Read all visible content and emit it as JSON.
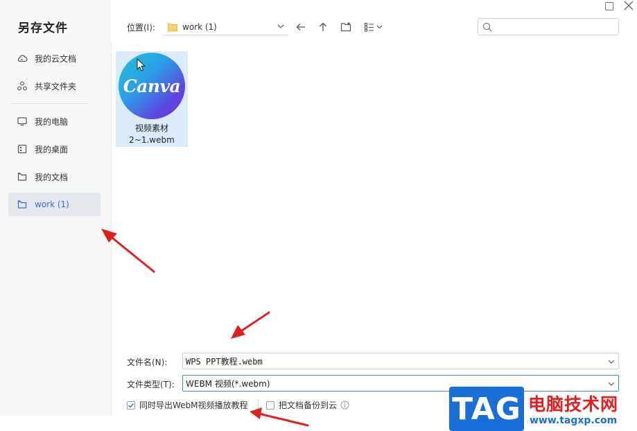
{
  "dialog": {
    "title": "另存文件"
  },
  "sidebar": {
    "items": [
      {
        "label": "我的云文档",
        "icon": "cloud-icon"
      },
      {
        "label": "共享文件夹",
        "icon": "share-icon"
      },
      {
        "label": "我的电脑",
        "icon": "monitor-icon"
      },
      {
        "label": "我的桌面",
        "icon": "desktop-icon"
      },
      {
        "label": "我的文档",
        "icon": "document-icon"
      },
      {
        "label": "work (1)",
        "icon": "folder-icon",
        "active": true
      }
    ]
  },
  "toolbar": {
    "location_label": "位置(I):",
    "location_value": "work (1)",
    "search_placeholder": ""
  },
  "files": [
    {
      "logo_text": "Canva",
      "name_line1": "视频素材",
      "name_line2": "2~1.webm"
    }
  ],
  "form": {
    "filename_label": "文件名(N):",
    "filename_value": "WPS PPT教程.webm",
    "filetype_label": "文件类型(T):",
    "filetype_value": "WEBM 视频(*.webm)",
    "export_tutorial_label": "同时导出WebM视频播放教程",
    "export_tutorial_checked": true,
    "backup_cloud_label": "把文档备份到云",
    "backup_cloud_checked": false
  },
  "watermark": {
    "tag": "TAG",
    "site_name": "电脑技术网",
    "url": "www.tagxp.com"
  },
  "colors": {
    "accent": "#3b6bdb",
    "selected_bg": "#dcebfa",
    "annotation_arrow": "#e02020",
    "watermark_blue": "#1a6fd6",
    "watermark_red": "#e51d1d"
  }
}
